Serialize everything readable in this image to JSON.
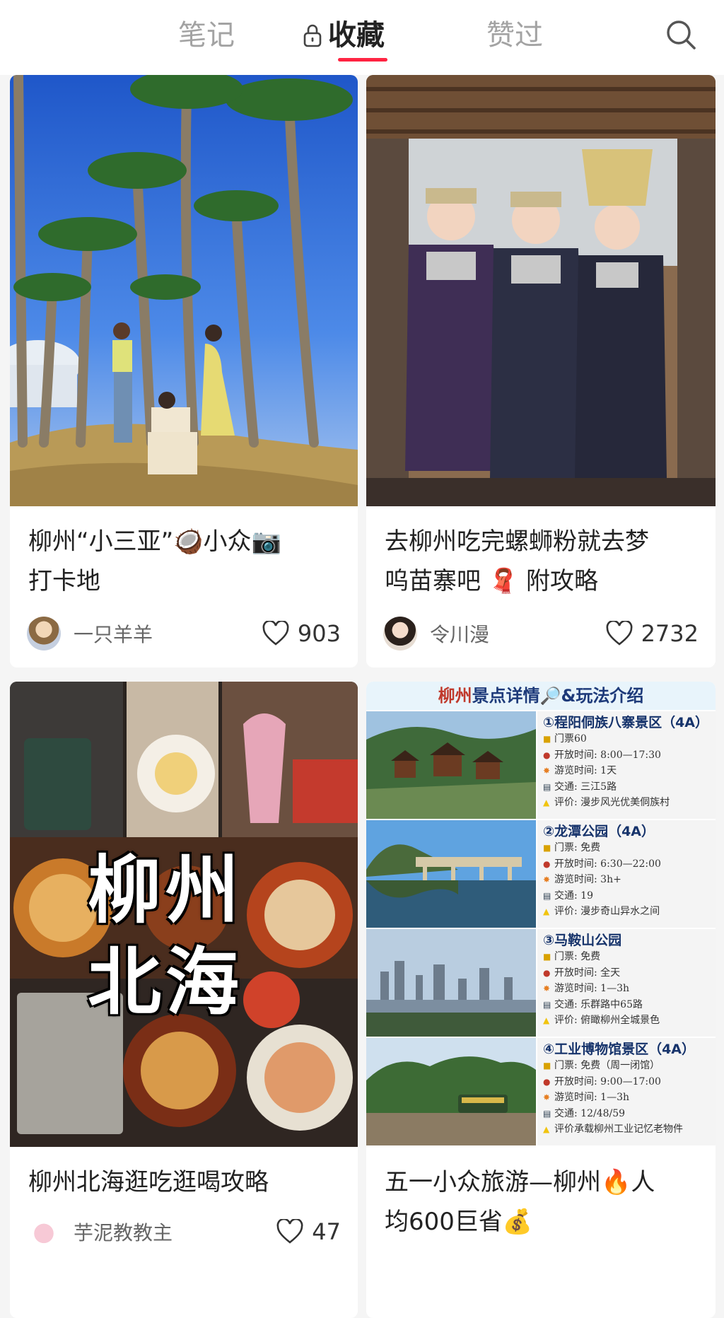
{
  "tabs": {
    "notes": "笔记",
    "favorites": "收藏",
    "liked": "赞过",
    "active": "favorites"
  },
  "colors": {
    "accent": "#ff2442",
    "inactive_tab": "#a3a3a3"
  },
  "icons": {
    "lock": "lock-icon",
    "search": "search-icon",
    "heart": "heart-icon"
  },
  "cards": [
    {
      "title": "柳州“小三亚”🥥小众📷\n打卡地",
      "author": "一只羊羊",
      "likes": "903"
    },
    {
      "title": "去柳州吃完螺蛳粉就去梦\n呜苗寨吧 🧣 附攻略",
      "author": "令川漫",
      "likes": "2732"
    },
    {
      "title": "柳州北海逛吃逛喝攻略",
      "author": "芋泥教教主",
      "likes": "47",
      "cover_text": [
        "柳州",
        "北海"
      ]
    },
    {
      "title": "五一小众旅游—柳州🔥人\n均600巨省💰",
      "cover": {
        "header_city": "柳州",
        "header_rest": "景点详情🔎&玩法介绍",
        "spots": [
          {
            "name": "①程阳侗族八寨景区（4A）",
            "rows": [
              [
                "门票",
                "门票60"
              ],
              [
                "开放",
                "开放时间:  8:00—17:30"
              ],
              [
                "游览",
                "游览时间:  1天"
              ],
              [
                "交通",
                "交通:  三江5路"
              ],
              [
                "评价",
                "评价:  漫步风光优美侗族村"
              ]
            ]
          },
          {
            "name": "②龙潭公园（4A）",
            "rows": [
              [
                "门票",
                "门票:  免费"
              ],
              [
                "开放",
                "开放时间:  6:30—22:00"
              ],
              [
                "游览",
                "游览时间:  3h+"
              ],
              [
                "交通",
                "交通:  19"
              ],
              [
                "评价",
                "评价:  漫步奇山异水之间"
              ]
            ]
          },
          {
            "name": "③马鞍山公园",
            "rows": [
              [
                "门票",
                "门票:  免费"
              ],
              [
                "开放",
                "开放时间:  全天"
              ],
              [
                "游览",
                "游览时间:  1—3h"
              ],
              [
                "交通",
                "交通:  乐群路中65路"
              ],
              [
                "评价",
                "评价:  俯瞰柳州全城景色"
              ]
            ]
          },
          {
            "name": "④工业博物馆景区（4A）",
            "rows": [
              [
                "门票",
                "门票:  免费（周一闭馆）"
              ],
              [
                "开放",
                "开放时间:  9:00—17:00"
              ],
              [
                "游览",
                "游览时间:  1—3h"
              ],
              [
                "交通",
                "交通:  12/48/59"
              ],
              [
                "评价",
                "评价承载柳州工业记忆老物件"
              ]
            ]
          }
        ]
      }
    }
  ]
}
